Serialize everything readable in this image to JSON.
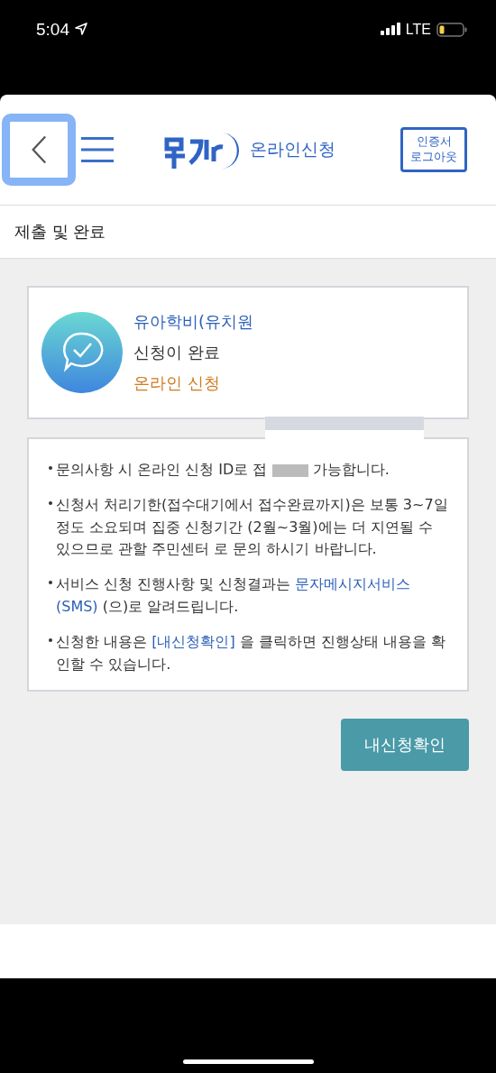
{
  "status_bar": {
    "time": "5:04",
    "network": "LTE"
  },
  "header": {
    "logo_text": "온라인신청",
    "logout_button": "인증서\n로그아웃"
  },
  "section_title": "제출 및 완료",
  "result_card": {
    "title": "유아학비(유치원",
    "message": "신청이 완료",
    "method": "온라인 신청"
  },
  "notices": [
    {
      "parts": [
        {
          "kind": "text",
          "text": "문의사항 시 온라인 신청 ID로 접"
        },
        {
          "kind": "redaction"
        },
        {
          "kind": "text",
          "text": "가능합니다."
        }
      ]
    },
    {
      "parts": [
        {
          "kind": "text",
          "text": "신청서 처리기한(접수대기에서 접수완료까지)은 보통 3~7일 정도 소요되며 집중 신청기간 (2월~3월)에는 더 지연될 수 있으므로 관할 주민센터 로 문의 하시기 바랍니다."
        }
      ]
    },
    {
      "parts": [
        {
          "kind": "text",
          "text": "서비스 신청 진행사항 및 신청결과는"
        },
        {
          "kind": "link",
          "text": "문자메시지서비스"
        },
        {
          "kind": "link",
          "text": "(SMS)"
        },
        {
          "kind": "text",
          "text": "(으)로 알려드립니다."
        }
      ]
    },
    {
      "parts": [
        {
          "kind": "text",
          "text": "신청한 내용은"
        },
        {
          "kind": "link",
          "text": "[내신청확인]"
        },
        {
          "kind": "text",
          "text": "을 클릭하면 진행상태 내용을 확인할 수 있습니다."
        }
      ]
    }
  ],
  "confirm_button": "내신청확인"
}
